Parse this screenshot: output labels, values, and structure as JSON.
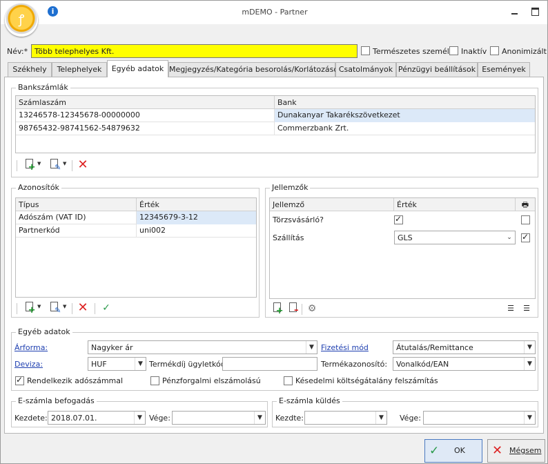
{
  "window": {
    "title": "mDEMO - Partner"
  },
  "name": {
    "label": "Név:*",
    "value": "Több telephelyes Kft."
  },
  "flags": [
    {
      "label": "Természetes személy",
      "checked": false
    },
    {
      "label": "Inaktív",
      "checked": false
    },
    {
      "label": "Anonimizált",
      "checked": false
    }
  ],
  "tabs": [
    "Székhely",
    "Telephelyek",
    "Egyéb adatok",
    "Megjegyzés/Kategória besorolás/Korlátozások",
    "Csatolmányok",
    "Pénzügyi beállítások",
    "Események"
  ],
  "active_tab": "Egyéb adatok",
  "bank": {
    "title": "Bankszámlák",
    "columns": [
      "Számlaszám",
      "Bank"
    ],
    "rows": [
      [
        "13246578-12345678-00000000",
        "Dunakanyar Takarékszövetkezet"
      ],
      [
        "98765432-98741562-54879632",
        "Commerzbank Zrt."
      ]
    ]
  },
  "ids": {
    "title": "Azonosítók",
    "columns": [
      "Típus",
      "Érték"
    ],
    "rows": [
      [
        "Adószám (VAT ID)",
        "12345679-3-12"
      ],
      [
        "Partnerkód",
        "uni002"
      ]
    ]
  },
  "attrs": {
    "title": "Jellemzők",
    "columns": [
      "Jellemző",
      "Érték"
    ],
    "rows": [
      {
        "name": "Törzsvásárló?",
        "value": "",
        "value_checked": true,
        "flag": false
      },
      {
        "name": "Szállítás",
        "value": "GLS",
        "flag": true
      }
    ]
  },
  "other": {
    "title": "Egyéb adatok",
    "arforma": {
      "label": "Árforma:",
      "value": "Nagyker ár"
    },
    "fizetesi": {
      "label": "Fizetési mód",
      "value": "Átutalás/Remittance"
    },
    "deviza": {
      "label": "Deviza:",
      "value": "HUF"
    },
    "termekdij": {
      "label": "Termékdíj ügyletkód:",
      "value": ""
    },
    "termekazon": {
      "label": "Termékazonosító:",
      "value": "Vonalkód/EAN"
    },
    "checks": [
      {
        "label": "Rendelkezik adószámmal",
        "checked": true
      },
      {
        "label": "Pénzforgalmi elszámolású",
        "checked": false
      },
      {
        "label": "Késedelmi költségátalány felszámítás",
        "checked": false
      }
    ]
  },
  "einvoice_in": {
    "title": "E-számla befogadás",
    "start_label": "Kezdete:",
    "start_value": "2018.07.01.",
    "end_label": "Vége:",
    "end_value": ""
  },
  "einvoice_out": {
    "title": "E-számla küldés",
    "start_label": "Kezdte:",
    "start_value": "",
    "end_label": "Vége:",
    "end_value": ""
  },
  "buttons": {
    "ok": "OK",
    "cancel": "Mégsem"
  },
  "colors": {
    "name_highlight": "#ffff00",
    "selected_row": "#dce9f8",
    "link": "#1e3fb0"
  }
}
